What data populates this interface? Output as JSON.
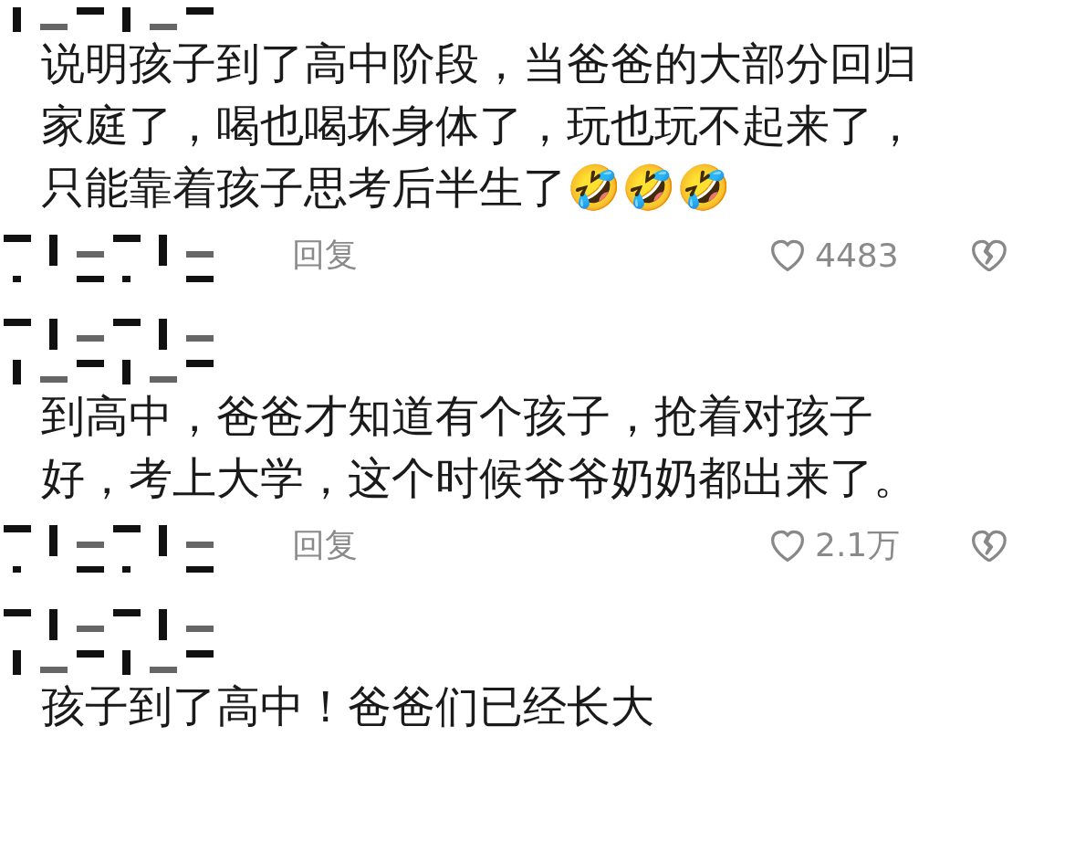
{
  "comments": [
    {
      "lines": [
        "说明孩子到了高中阶段，当爸爸的大部分回归",
        "家庭了，喝也喝坏身体了，玩也玩不起来了，",
        "只能靠着孩子思考后半生了🤣🤣🤣"
      ],
      "actions": {
        "reply": "回复",
        "likes": "4483",
        "liked": false
      }
    },
    {
      "lines": [
        "到高中，爸爸才知道有个孩子，抢着对孩子",
        "好，考上大学，这个时候爷爷奶奶都出来了。"
      ],
      "actions": {
        "reply": "回复",
        "likes": "2.1万",
        "liked": false
      }
    },
    {
      "lines": [
        "孩子到了高中！爸爸们已经长大"
      ]
    }
  ]
}
